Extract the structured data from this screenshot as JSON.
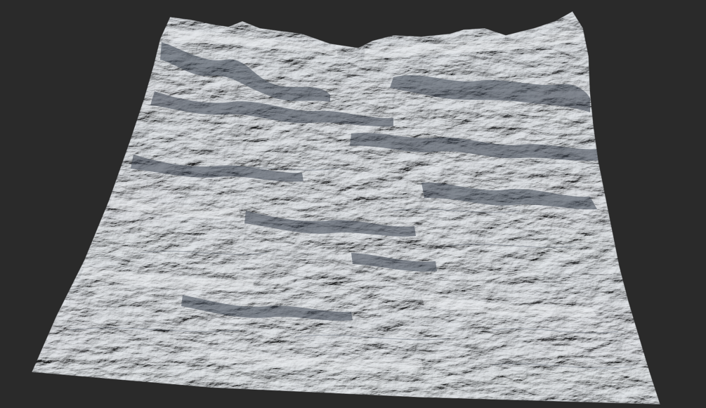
{
  "scene": {
    "background_color": "#2a2a2a",
    "terrain_base_color": "#c8ccd0",
    "terrain_highlight_color": "#e6e9ec",
    "terrain_shadow_color": "#3a4250",
    "terrain_mid_shadow_color": "#8a9099",
    "subject": "heightmap-terrain-render"
  }
}
